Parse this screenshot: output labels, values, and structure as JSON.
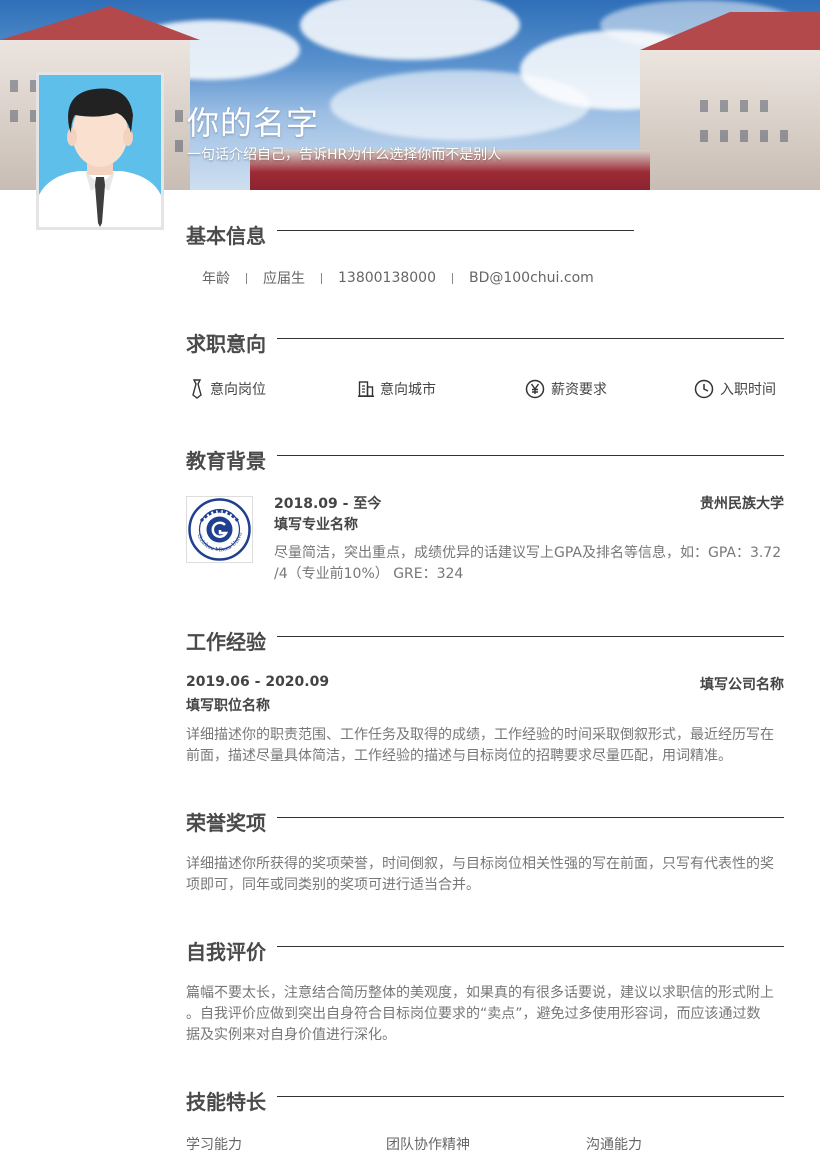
{
  "header": {
    "name": "你的名字",
    "tagline": "一句话介绍自己，告诉HR为什么选择你而不是别人"
  },
  "sections": {
    "basic": {
      "title": "基本信息",
      "age": "年龄",
      "status": "应届生",
      "phone": "13800138000",
      "email": "BD@100chui.com"
    },
    "intent": {
      "title": "求职意向",
      "position": "意向岗位",
      "city": "意向城市",
      "salary": "薪资要求",
      "start": "入职时间"
    },
    "education": {
      "title": "教育背景",
      "period": "2018.09 - 至今",
      "school": "贵州民族大学",
      "major": "填写专业名称",
      "desc_line1": "尽量简洁，突出重点，成绩优异的话建议写上GPA及排名等信息，如：GPA：3.72",
      "desc_line2": "/4（专业前10%） GRE：324",
      "logo_text": "Guizhou Minzu University",
      "logo_year": "1951"
    },
    "work": {
      "title": "工作经验",
      "period": "2019.06 - 2020.09",
      "company": "填写公司名称",
      "role": "填写职位名称",
      "desc_line1": "详细描述你的职责范围、工作任务及取得的成绩，工作经验的时间采取倒叙形式，最近经历写在",
      "desc_line2": "前面，描述尽量具体简洁，工作经验的描述与目标岗位的招聘要求尽量匹配，用词精准。"
    },
    "honors": {
      "title": "荣誉奖项",
      "desc_line1": "详细描述你所获得的奖项荣誉，时间倒叙，与目标岗位相关性强的写在前面，只写有代表性的奖",
      "desc_line2": "项即可，同年或同类别的奖项可进行适当合并。"
    },
    "self": {
      "title": "自我评价",
      "desc_line1": "篇幅不要太长，注意结合简历整体的美观度，如果真的有很多话要说，建议以求职信的形式附上",
      "desc_line2": "。自我评价应做到突出自身符合目标岗位要求的“卖点”，避免过多使用形容词，而应该通过数",
      "desc_line3": "据及实例来对自身价值进行深化。"
    },
    "skills": {
      "title": "技能特长",
      "items": [
        "学习能力",
        "团队协作精神",
        "沟通能力"
      ]
    }
  },
  "icons": {
    "position": "tie-icon",
    "city": "building-icon",
    "salary": "yen-icon",
    "start": "clock-icon"
  },
  "colors": {
    "heading": "#4a4a4a",
    "rule": "#333333",
    "body": "#777777"
  }
}
